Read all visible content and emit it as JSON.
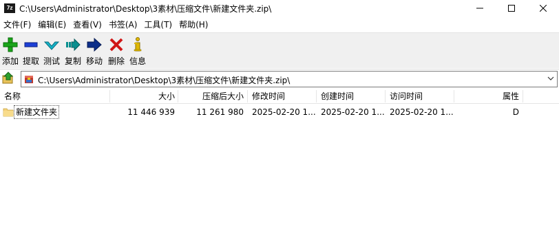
{
  "window": {
    "title": "C:\\Users\\Administrator\\Desktop\\3素材\\压缩文件\\新建文件夹.zip\\",
    "app_icon_text": "7z",
    "minimize_icon": "minimize-icon",
    "maximize_icon": "maximize-icon",
    "close_icon": "close-icon"
  },
  "menu": {
    "items": [
      {
        "label": "文件(F)"
      },
      {
        "label": "编辑(E)"
      },
      {
        "label": "查看(V)"
      },
      {
        "label": "书签(A)"
      },
      {
        "label": "工具(T)"
      },
      {
        "label": "帮助(H)"
      }
    ]
  },
  "toolbar": {
    "add": {
      "label": "添加",
      "icon": "plus-icon",
      "color": "#1aa51a"
    },
    "extract": {
      "label": "提取",
      "icon": "minus-icon",
      "color": "#1c3fd6"
    },
    "test": {
      "label": "测试",
      "icon": "check-icon",
      "color": "#16b3c8"
    },
    "copy": {
      "label": "复制",
      "icon": "copy-arrow-icon",
      "color": "#0a8f8f"
    },
    "move": {
      "label": "移动",
      "icon": "move-arrow-icon",
      "color": "#0d2f8a"
    },
    "delete": {
      "label": "删除",
      "icon": "delete-x-icon",
      "color": "#d01616"
    },
    "info": {
      "label": "信息",
      "icon": "info-icon",
      "color": "#e0b800"
    }
  },
  "address": {
    "path": "C:\\Users\\Administrator\\Desktop\\3素材\\压缩文件\\新建文件夹.zip\\",
    "up_icon": "folder-up-icon",
    "archive_icon": "zip-archive-icon",
    "dropdown_icon": "chevron-down-icon"
  },
  "columns": {
    "name": "名称",
    "size": "大小",
    "packed": "压缩后大小",
    "modified": "修改时间",
    "created": "创建时间",
    "accessed": "访问时间",
    "attributes": "属性"
  },
  "rows": [
    {
      "name": "新建文件夹",
      "icon": "folder-icon",
      "size": "11 446 939",
      "packed": "11 261 980",
      "modified": "2025-02-20 1...",
      "created": "2025-02-20 1...",
      "accessed": "2025-02-20 1...",
      "attributes": "D"
    }
  ]
}
